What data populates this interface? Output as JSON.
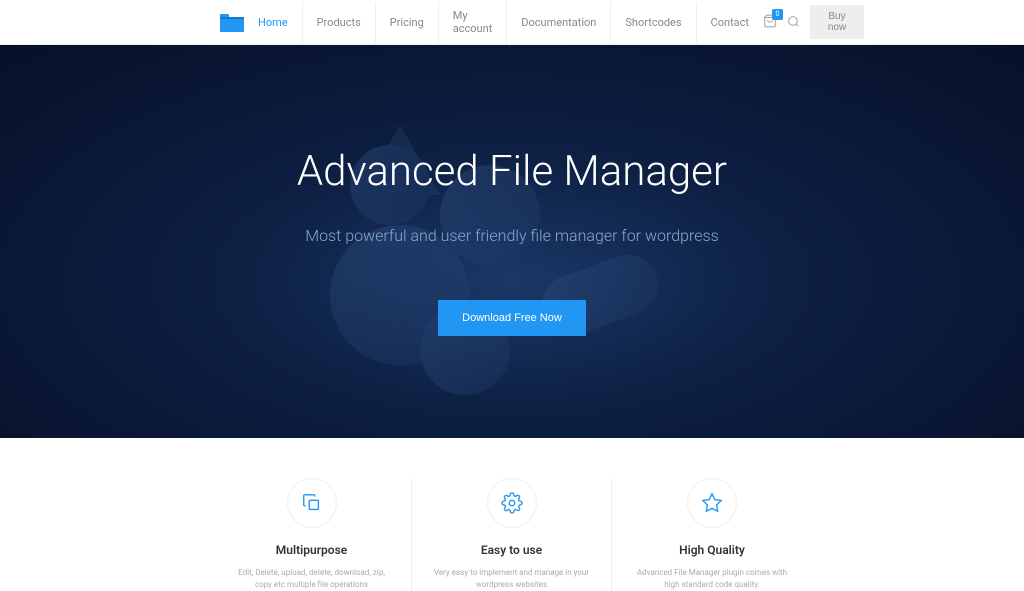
{
  "nav": {
    "items": [
      {
        "label": "Home",
        "active": true
      },
      {
        "label": "Products",
        "active": false
      },
      {
        "label": "Pricing",
        "active": false
      },
      {
        "label": "My account",
        "active": false
      },
      {
        "label": "Documentation",
        "active": false
      },
      {
        "label": "Shortcodes",
        "active": false
      },
      {
        "label": "Contact",
        "active": false
      }
    ],
    "cart_count": "0",
    "buy_label": "Buy now"
  },
  "hero": {
    "title": "Advanced File Manager",
    "subtitle": "Most powerful and user friendly file manager for wordpress",
    "cta_label": "Download Free Now"
  },
  "features": [
    {
      "icon": "copy-icon",
      "title": "Multipurpose",
      "desc": "Edit, Delete, upload, delete, download, zip, copy etc multiple file operations"
    },
    {
      "icon": "gear-icon",
      "title": "Easy to use",
      "desc": "Very easy to implement and manage in your wordpress websites"
    },
    {
      "icon": "star-icon",
      "title": "High Quality",
      "desc": "Advanced File Manager plugin comes with high standard code quality."
    }
  ]
}
